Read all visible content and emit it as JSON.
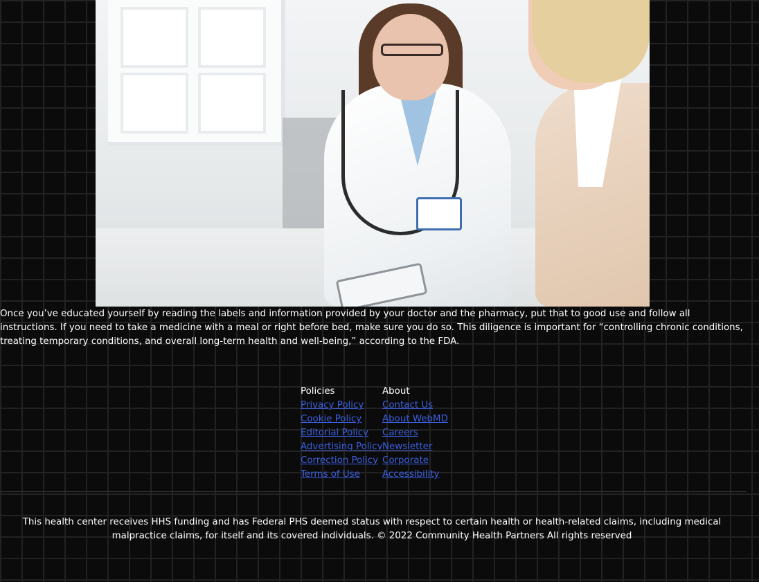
{
  "hero_image": {
    "subject": "doctor-consulting-patient-photo"
  },
  "article": {
    "paragraph": "Once you’ve educated yourself by reading the labels and information provided by your doctor and the pharmacy, put that to good use and follow all instructions. If you need to take a medicine with a meal or right before bed, make sure you do so. This diligence is important for “controlling chronic conditions, treating temporary conditions, and overall long-term health and well-being,” according to the FDA."
  },
  "footer": {
    "policies": {
      "title": "Policies",
      "links": [
        "Privacy Policy",
        "Cookie Policy",
        "Editorial Policy",
        "Advertising Policy",
        "Correction Policy",
        "Terms of Use"
      ]
    },
    "about": {
      "title": "About",
      "links": [
        "Contact Us",
        "About WebMD",
        "Careers",
        "Newsletter",
        "Corporate",
        "Accessibility"
      ]
    },
    "legal": "This health center receives HHS funding and has Federal PHS deemed status with respect to certain health or health-related claims, including medical malpractice claims, for itself and its covered individuals. © 2022 Community Health Partners All rights reserved"
  },
  "colors": {
    "background": "#0b0b0b",
    "text": "#ffffff",
    "link": "#3b5fe0"
  }
}
